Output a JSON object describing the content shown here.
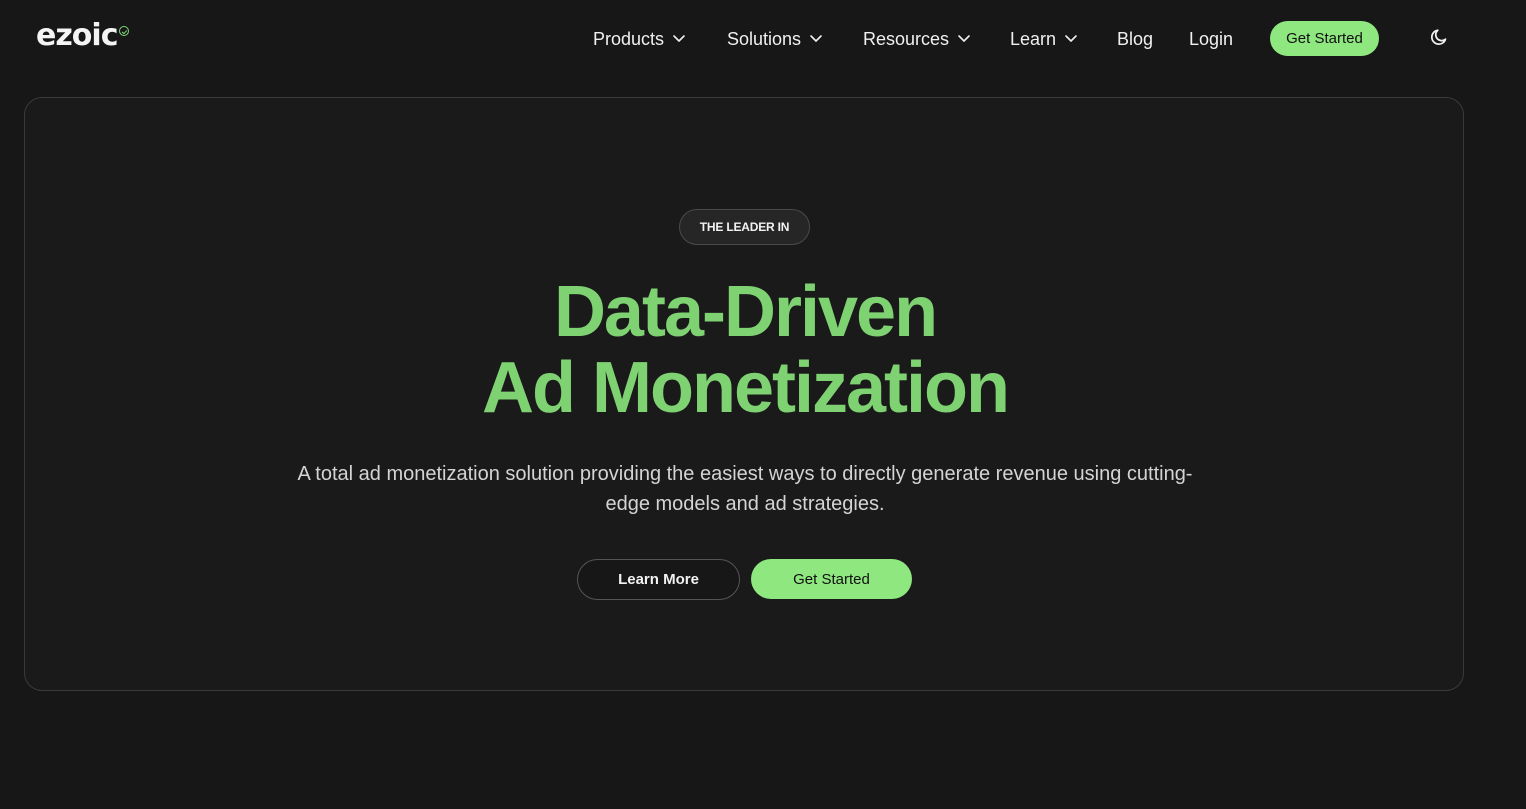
{
  "header": {
    "logo_text": "ezoic",
    "nav": {
      "products": "Products",
      "solutions": "Solutions",
      "resources": "Resources",
      "learn": "Learn",
      "blog": "Blog",
      "login": "Login"
    },
    "cta_label": "Get Started",
    "theme_icon": "moon-icon"
  },
  "hero": {
    "badge": "THE LEADER IN",
    "headline_line1": "Data-Driven",
    "headline_line2": "Ad Monetization",
    "description": "A total ad monetization solution providing the easiest ways to directly generate revenue using cutting-edge models and ad strategies.",
    "learn_more_label": "Learn More",
    "get_started_label": "Get Started"
  },
  "colors": {
    "background": "#171717",
    "accent_green": "#8ee77f",
    "headline_green": "#7fd272",
    "text": "#f2f2f2"
  }
}
